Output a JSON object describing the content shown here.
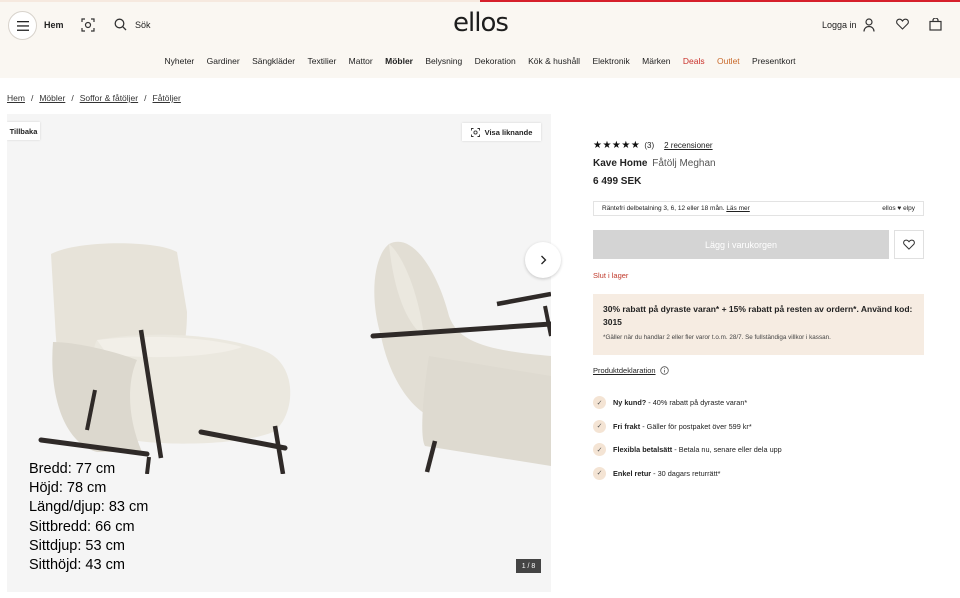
{
  "header": {
    "home_label": "Hem",
    "search_label": "Sök",
    "logo": "ellos",
    "login_label": "Logga in"
  },
  "nav": {
    "items": [
      "Nyheter",
      "Gardiner",
      "Sängkläder",
      "Textilier",
      "Mattor",
      "Möbler",
      "Belysning",
      "Dekoration",
      "Kök & hushåll",
      "Elektronik",
      "Märken",
      "Deals",
      "Outlet",
      "Presentkort"
    ]
  },
  "breadcrumb": [
    "Hem",
    "Möbler",
    "Soffor & fåtöljer",
    "Fåtöljer"
  ],
  "gallery": {
    "back_label": "Tillbaka",
    "similar_label": "Visa liknande",
    "counter": "1 / 8",
    "dimensions": [
      "Bredd: 77 cm",
      "Höjd: 78 cm",
      "Längd/djup: 83 cm",
      "Sittbredd: 66 cm",
      "Sittdjup: 53 cm",
      "Sitthöjd: 43 cm"
    ]
  },
  "product": {
    "stars": "★★★★★",
    "rating_count": "(3)",
    "reviews_link": "2 recensioner",
    "brand": "Kave Home",
    "name": "Fåtölj Meghan",
    "price": "6 499 SEK",
    "credit_text": "Räntefri delbetalning 3, 6, 12 eller 18 mån.",
    "credit_link": "Läs mer",
    "credit_brand": "ellos ♥ elpy",
    "cart_label": "Lägg i varukorgen",
    "stock_status": "Slut i lager",
    "promo_main": "30% rabatt på dyraste varan* + 15% rabatt på resten av ordern*. Använd kod: 3015",
    "promo_small": "*Gäller när du handlar 2 eller fler varor t.o.m. 28/7. Se fullständiga villkor i kassan.",
    "declaration_link": "Produktdeklaration"
  },
  "usps": [
    {
      "title": "Ny kund?",
      "text": " - 40% rabatt på dyraste varan*"
    },
    {
      "title": "Fri frakt",
      "text": " - Gäller för postpaket över 599 kr*"
    },
    {
      "title": "Flexibla betalsätt",
      "text": " - Betala nu, senare eller dela upp"
    },
    {
      "title": "Enkel retur",
      "text": " - 30 dagars returrätt*"
    }
  ],
  "colors": {
    "header_bg": "#faf7f2",
    "deals": "#c9312b",
    "outlet": "#c96a2b",
    "stock": "#c0392b",
    "promo_bg": "#f6ece2",
    "cart_disabled": "#d4d4d4"
  }
}
